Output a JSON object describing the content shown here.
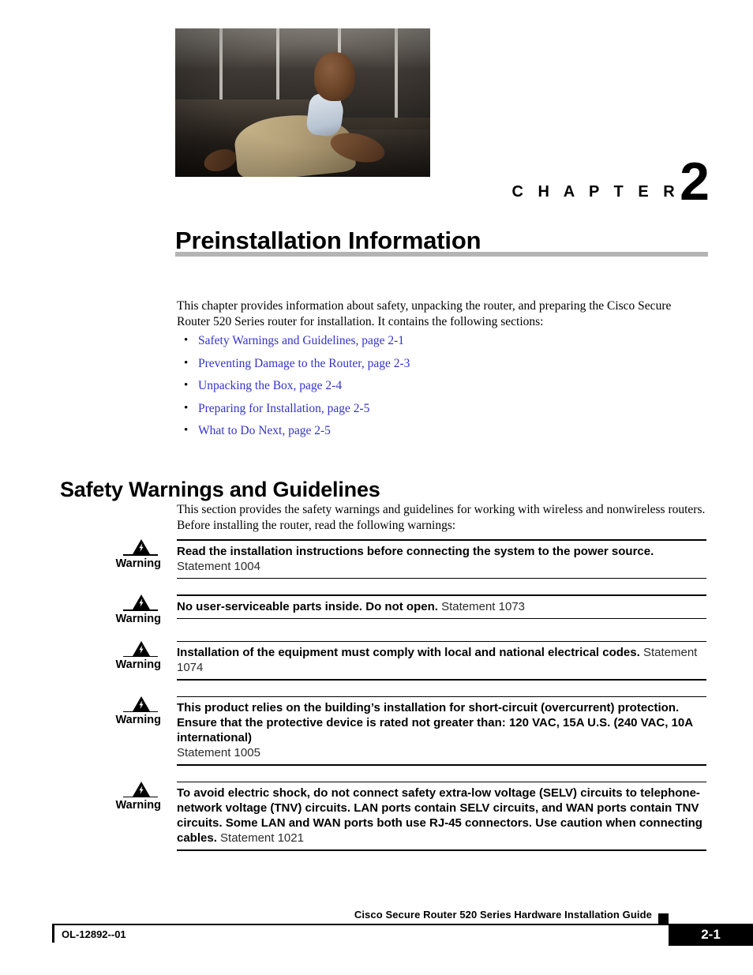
{
  "document": {
    "chapter_word": "C H A P T E R",
    "chapter_number": "2",
    "chapter_title": "Preinstallation Information",
    "photo_alt": "seated-man-in-tan-jacket-photo"
  },
  "intro": {
    "paragraph": "This chapter provides information about safety, unpacking the router, and preparing the Cisco Secure Router 520 Series router for installation. It contains the following sections:"
  },
  "toc": {
    "bullet_glyph": "•",
    "items": [
      "Safety Warnings and Guidelines, page 2-1",
      "Preventing Damage to the Router, page 2-3",
      "Unpacking the Box, page 2-4",
      "Preparing for Installation, page 2-5",
      "What to Do Next, page 2-5"
    ],
    "link_color": "#3333cc"
  },
  "section": {
    "heading": "Safety Warnings and Guidelines",
    "paragraph": "This section provides the safety warnings and guidelines for working with wireless and nonwireless routers. Before installing the router, read the following warnings:"
  },
  "warnings": {
    "label": "Warning",
    "icon": "warning-triangle-lightning-icon",
    "items": [
      {
        "text": "Read the installation instructions before connecting the system to the power source.",
        "statement": "Statement 1004",
        "statement_on_own_line": false
      },
      {
        "text": "No user-serviceable parts inside. Do not open.",
        "statement": "Statement 1073",
        "statement_on_own_line": false
      },
      {
        "text": "Installation of the equipment must comply with local and national electrical codes.",
        "statement": "Statement 1074",
        "statement_on_own_line": false
      },
      {
        "text": "This product relies on the building’s installation for short-circuit (overcurrent) protection. Ensure that the protective device is rated not greater than: 120 VAC, 15A U.S. (240 VAC, 10A international)",
        "statement": "Statement 1005",
        "statement_on_own_line": true
      },
      {
        "text": "To avoid electric shock, do not connect safety extra-low voltage (SELV) circuits to telephone-network voltage (TNV) circuits. LAN ports contain SELV circuits, and WAN ports contain TNV circuits. Some LAN and WAN ports both use RJ-45 connectors. Use caution when connecting cables.",
        "statement": "Statement 1021",
        "statement_on_own_line": false
      }
    ]
  },
  "footer": {
    "guide_title": "Cisco Secure Router 520 Series Hardware Installation Guide",
    "doc_id": "OL-12892--01",
    "page_number": "2-1"
  }
}
